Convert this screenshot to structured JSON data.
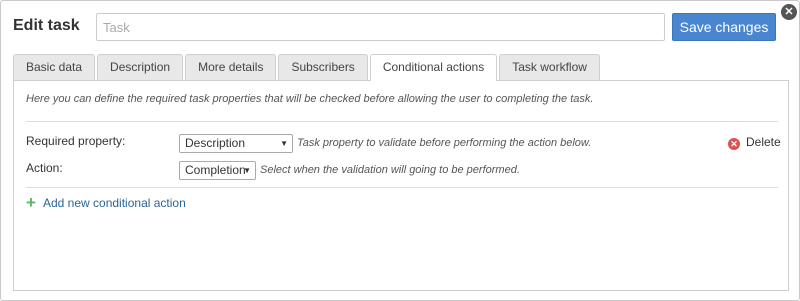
{
  "dialog": {
    "title": "Edit task",
    "name_placeholder": "Task",
    "save_label": "Save changes",
    "close_glyph": "✕"
  },
  "tabs": [
    {
      "label": "Basic data",
      "active": false
    },
    {
      "label": "Description",
      "active": false
    },
    {
      "label": "More details",
      "active": false
    },
    {
      "label": "Subscribers",
      "active": false
    },
    {
      "label": "Conditional actions",
      "active": true
    },
    {
      "label": "Task workflow",
      "active": false
    }
  ],
  "conditional_actions": {
    "intro": "Here you can define the required task properties that will be checked before allowing the user to completing the task.",
    "required_property": {
      "label": "Required property:",
      "value": "Description",
      "hint": "Task property to validate before performing the action below."
    },
    "action": {
      "label": "Action:",
      "value": "Completion",
      "hint": "Select when the validation will going to be performed."
    },
    "delete_label": "Delete",
    "add_label": "Add new conditional action"
  },
  "icons": {
    "close": "close-icon",
    "delete": "delete-circle-icon",
    "add": "plus-icon",
    "dropdown": "caret-down-icon"
  },
  "colors": {
    "primary": "#4a86cf",
    "danger": "#d9534f",
    "success": "#5cb85c",
    "link": "#2a6496"
  }
}
